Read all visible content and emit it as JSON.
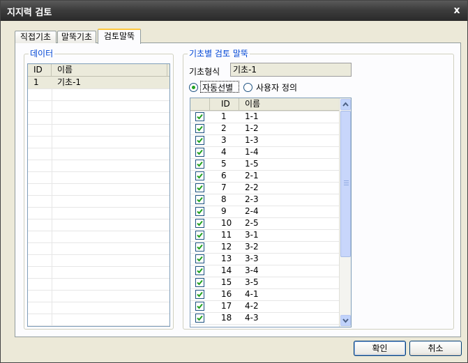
{
  "window": {
    "title": "지지력 검토",
    "close_label": "x"
  },
  "tabs": [
    {
      "label": "직접기초",
      "active": false
    },
    {
      "label": "말뚝기초",
      "active": false
    },
    {
      "label": "검토말뚝",
      "active": true
    }
  ],
  "data_group": {
    "legend": "데이터",
    "columns": [
      "ID",
      "이름"
    ],
    "rows": [
      {
        "id": "1",
        "name": "기초-1",
        "selected": true
      }
    ]
  },
  "pile_group": {
    "legend": "기초별 검토 말뚝",
    "foundation_type_label": "기초형식",
    "foundation_type_value": "기초-1",
    "radio_auto": {
      "label": "자동선별",
      "selected": true
    },
    "radio_user": {
      "label": "사용자 정의",
      "selected": false
    },
    "columns": [
      "ID",
      "이름"
    ],
    "rows": [
      {
        "id": "1",
        "name": "1-1",
        "checked": true
      },
      {
        "id": "2",
        "name": "1-2",
        "checked": true
      },
      {
        "id": "3",
        "name": "1-3",
        "checked": true
      },
      {
        "id": "4",
        "name": "1-4",
        "checked": true
      },
      {
        "id": "5",
        "name": "1-5",
        "checked": true
      },
      {
        "id": "6",
        "name": "2-1",
        "checked": true
      },
      {
        "id": "7",
        "name": "2-2",
        "checked": true
      },
      {
        "id": "8",
        "name": "2-3",
        "checked": true
      },
      {
        "id": "9",
        "name": "2-4",
        "checked": true
      },
      {
        "id": "10",
        "name": "2-5",
        "checked": true
      },
      {
        "id": "11",
        "name": "3-1",
        "checked": true
      },
      {
        "id": "12",
        "name": "3-2",
        "checked": true
      },
      {
        "id": "13",
        "name": "3-3",
        "checked": true
      },
      {
        "id": "14",
        "name": "3-4",
        "checked": true
      },
      {
        "id": "15",
        "name": "3-5",
        "checked": true
      },
      {
        "id": "16",
        "name": "4-1",
        "checked": true
      },
      {
        "id": "17",
        "name": "4-2",
        "checked": true
      },
      {
        "id": "18",
        "name": "4-3",
        "checked": true
      }
    ]
  },
  "buttons": {
    "ok": "확인",
    "cancel": "취소"
  },
  "colors": {
    "accent": "#0046d5",
    "check": "#21a121",
    "tab_highlight": "#ffc73c"
  },
  "icons": {
    "close": "close-icon",
    "check": "checkmark-icon",
    "scroll_up": "chevron-up-icon",
    "scroll_down": "chevron-down-icon"
  }
}
